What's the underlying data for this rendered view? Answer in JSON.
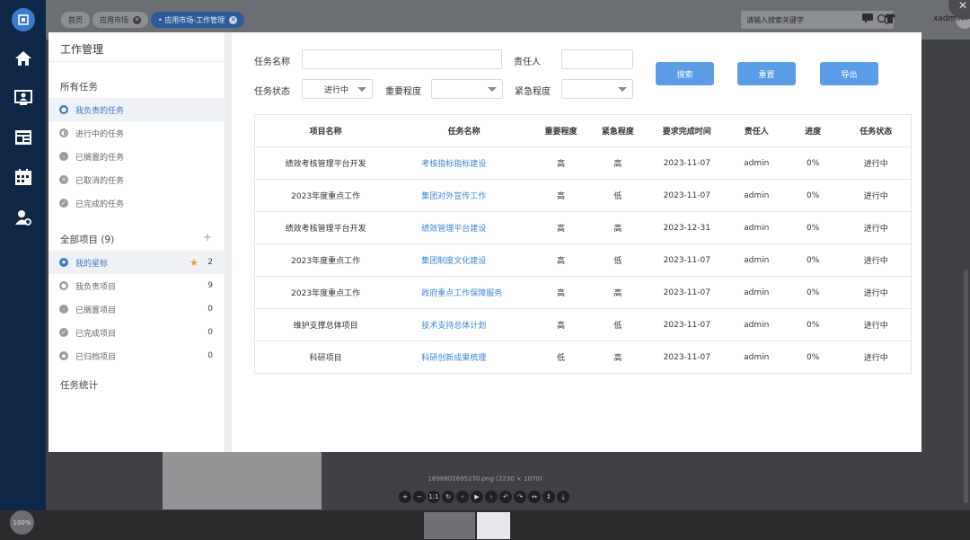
{
  "app": {
    "tabs": [
      {
        "label": "首页"
      },
      {
        "label": "应用市场"
      },
      {
        "label": "• 应用市场-工作管理"
      }
    ],
    "search_placeholder": "请输入搜索关键字",
    "user": "xadmin"
  },
  "viewer": {
    "caption": "1698802695270.png (2230 × 1070)",
    "zoom": "100%"
  },
  "sidebar": {
    "title": "工作管理",
    "all_tasks_label": "所有任务",
    "tasks": [
      {
        "label": "我负责的任务",
        "icon": "person-icon",
        "selected": true
      },
      {
        "label": "进行中的任务",
        "icon": "half-circle-icon",
        "selected": false
      },
      {
        "label": "已搁置的任务",
        "icon": "pause-icon",
        "selected": false
      },
      {
        "label": "已取消的任务",
        "icon": "cancel-icon",
        "selected": false
      },
      {
        "label": "已完成的任务",
        "icon": "check-icon",
        "selected": false
      }
    ],
    "projects_label": "全部项目  (9)",
    "projects": [
      {
        "label": "我的星标",
        "icon": "star-icon",
        "count": "2",
        "selected": true
      },
      {
        "label": "我负责项目",
        "icon": "person-icon",
        "count": "9",
        "selected": false
      },
      {
        "label": "已搁置项目",
        "icon": "pause-icon",
        "count": "0",
        "selected": false
      },
      {
        "label": "已完成项目",
        "icon": "check-icon",
        "count": "0",
        "selected": false
      },
      {
        "label": "已归档项目",
        "icon": "archive-icon",
        "count": "0",
        "selected": false
      }
    ],
    "stats_label": "任务统计"
  },
  "filters": {
    "task_name_label": "任务名称",
    "task_name_value": "",
    "owner_label": "责任人",
    "owner_value": "",
    "status_label": "任务状态",
    "status_value": "进行中",
    "importance_label": "重要程度",
    "importance_value": "",
    "urgency_label": "紧急程度",
    "urgency_value": "",
    "search_button": "搜索",
    "reset_button": "重置",
    "export_button": "导出"
  },
  "table": {
    "headers": [
      "项目名称",
      "任务名称",
      "重要程度",
      "紧急程度",
      "要求完成时间",
      "责任人",
      "进度",
      "任务状态"
    ],
    "rows": [
      [
        "绩效考核管理平台开发",
        "考核指标指标建设",
        "高",
        "高",
        "2023-11-07",
        "admin",
        "0%",
        "进行中"
      ],
      [
        "2023年度重点工作",
        "集团对外宣传工作",
        "高",
        "低",
        "2023-11-07",
        "admin",
        "0%",
        "进行中"
      ],
      [
        "绩效考核管理平台开发",
        "绩效管理平台建设",
        "高",
        "高",
        "2023-12-31",
        "admin",
        "0%",
        "进行中"
      ],
      [
        "2023年度重点工作",
        "集团制度文化建设",
        "高",
        "低",
        "2023-11-07",
        "admin",
        "0%",
        "进行中"
      ],
      [
        "2023年度重点工作",
        "政府重点工作保障服务",
        "高",
        "高",
        "2023-11-07",
        "admin",
        "0%",
        "进行中"
      ],
      [
        "维护支撑总体项目",
        "技术支持总体计划",
        "高",
        "低",
        "2023-11-07",
        "admin",
        "0%",
        "进行中"
      ],
      [
        "科研项目",
        "科研创新成果梳理",
        "低",
        "高",
        "2023-11-07",
        "admin",
        "0%",
        "进行中"
      ]
    ]
  }
}
